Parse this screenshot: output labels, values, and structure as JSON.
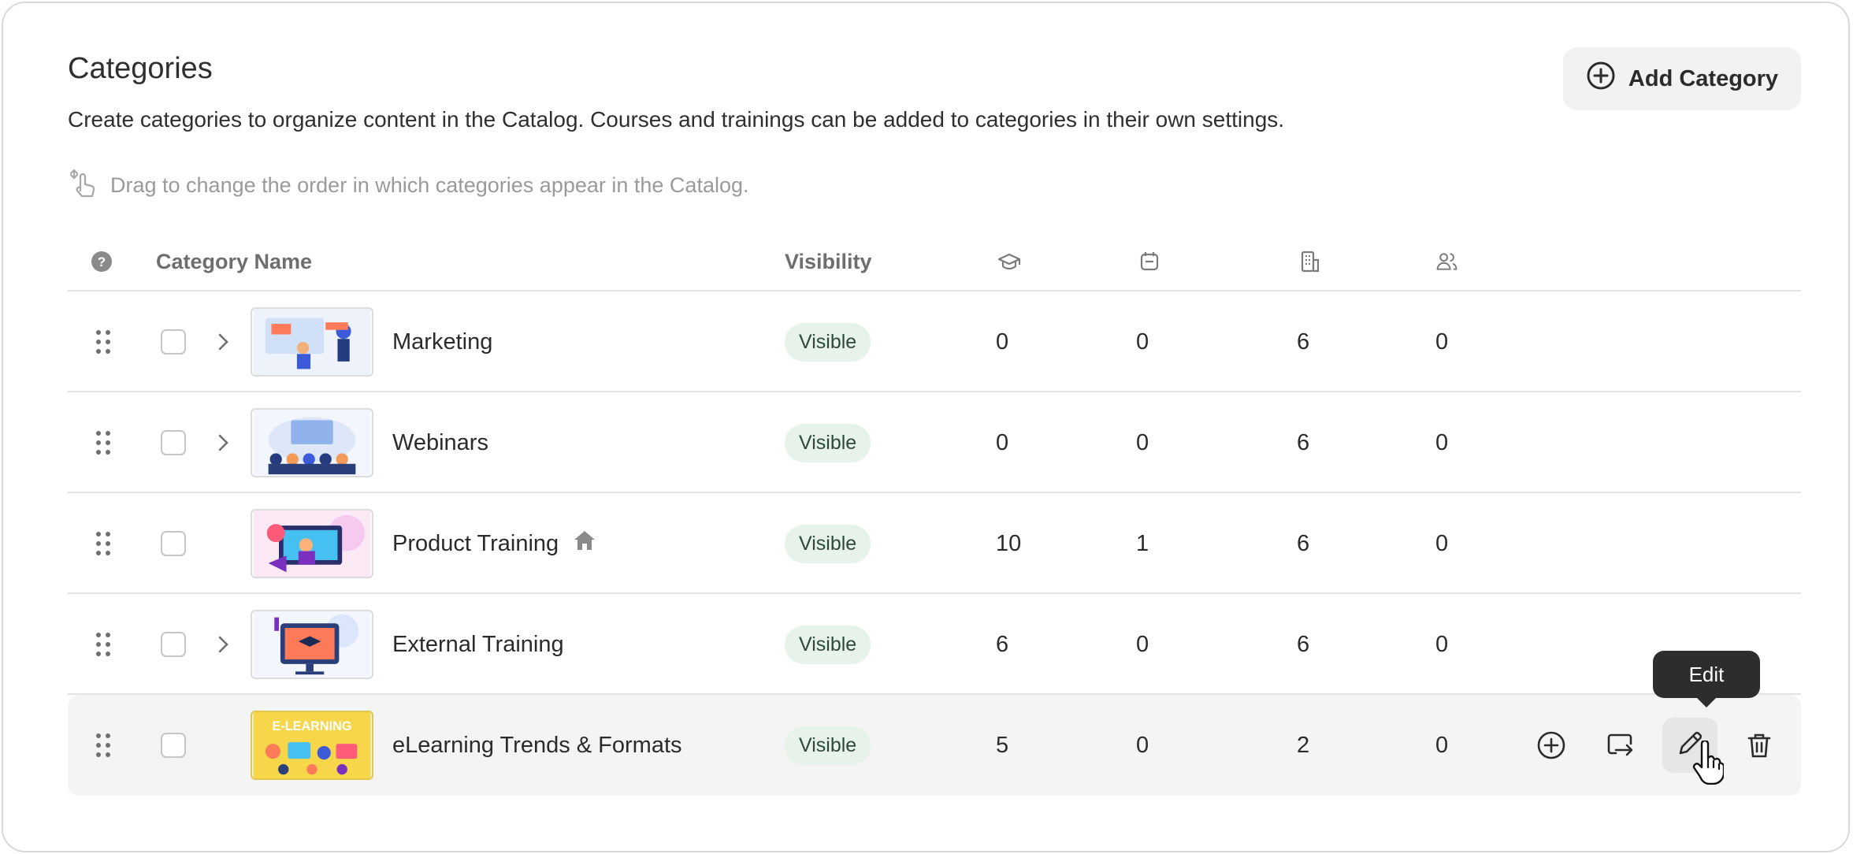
{
  "header": {
    "title": "Categories",
    "subtitle": "Create categories to organize content in the Catalog. Courses and trainings can be added to categories in their own settings.",
    "hint": "Drag to change the order in which categories appear in the Catalog.",
    "add_button_label": "Add Category"
  },
  "table": {
    "columns": {
      "help_icon": "question-circle-icon",
      "name": "Category Name",
      "visibility": "Visibility",
      "courses_icon": "graduation-cap-icon",
      "trainings_icon": "calendar-icon",
      "buildings_icon": "building-icon",
      "users_icon": "users-icon"
    },
    "rows": [
      {
        "name": "Marketing",
        "visibility": "Visible",
        "courses": "0",
        "trainings": "0",
        "buildings": "6",
        "users": "0",
        "expandable": true,
        "thumb": "marketing"
      },
      {
        "name": "Webinars",
        "visibility": "Visible",
        "courses": "0",
        "trainings": "0",
        "buildings": "6",
        "users": "0",
        "expandable": true,
        "thumb": "webinars"
      },
      {
        "name": "Product Training",
        "visibility": "Visible",
        "courses": "10",
        "trainings": "1",
        "buildings": "6",
        "users": "0",
        "expandable": false,
        "home": true,
        "thumb": "product"
      },
      {
        "name": "External Training",
        "visibility": "Visible",
        "courses": "6",
        "trainings": "0",
        "buildings": "6",
        "users": "0",
        "expandable": true,
        "thumb": "external"
      },
      {
        "name": "eLearning Trends & Formats",
        "visibility": "Visible",
        "courses": "5",
        "trainings": "0",
        "buildings": "2",
        "users": "0",
        "expandable": false,
        "thumb": "elearning",
        "thumb_text": "E-LEARNING"
      }
    ]
  },
  "row_actions": {
    "tooltip": "Edit",
    "icons": [
      "plus-circle-icon",
      "move-icon",
      "pencil-icon",
      "trash-icon"
    ]
  },
  "colors": {
    "badge_bg": "#e6f2ea",
    "hover_row_bg": "#f4f4f4",
    "tooltip_bg": "#2d2d2d"
  }
}
